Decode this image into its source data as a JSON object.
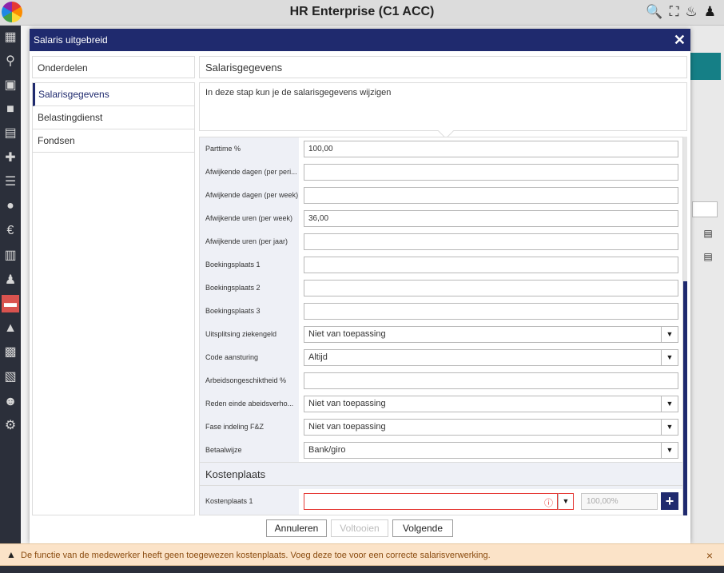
{
  "app": {
    "title": "HR Enterprise (C1 ACC)"
  },
  "topbar_icons": [
    "search-user-icon",
    "team-icon",
    "bell-icon",
    "user-icon"
  ],
  "sidebar_icons": [
    "dashboard-icon",
    "search-icon",
    "org-icon",
    "folder-icon",
    "calendar-icon",
    "medical-icon",
    "report-icon",
    "money-bag-icon",
    "euro-icon",
    "schedule-icon",
    "person-icon",
    "salary-icon",
    "bank-icon",
    "document-icon",
    "file-icon",
    "hand-user-icon",
    "settings-icon"
  ],
  "modal": {
    "title": "Salaris uitgebreid",
    "close_glyph": "✕",
    "nav_head": "Onderdelen",
    "nav_items": [
      "Salarisgegevens",
      "Belastingdienst",
      "Fondsen"
    ],
    "section_title": "Salarisgegevens",
    "info_text": "In deze stap kun je de salarisgegevens wijzigen",
    "fields": [
      {
        "label": "Parttime %",
        "value": "100,00"
      },
      {
        "label": "Afwijkende dagen (per peri...",
        "value": ""
      },
      {
        "label": "Afwijkende dagen (per week)",
        "value": ""
      },
      {
        "label": "Afwijkende uren (per week)",
        "value": "36,00"
      },
      {
        "label": "Afwijkende uren (per jaar)",
        "value": ""
      },
      {
        "label": "Boekingsplaats 1",
        "value": ""
      },
      {
        "label": "Boekingsplaats 2",
        "value": ""
      },
      {
        "label": "Boekingsplaats 3",
        "value": ""
      },
      {
        "label": "Uitsplitsing ziekengeld",
        "value": "Niet van toepassing"
      },
      {
        "label": "Code aansturing",
        "value": "Altijd"
      },
      {
        "label": "Arbeidsongeschiktheid %",
        "value": ""
      },
      {
        "label": "Reden einde abeidsverho...",
        "value": "Niet van toepassing"
      },
      {
        "label": "Fase indeling F&Z",
        "value": "Niet van toepassing"
      },
      {
        "label": "Betaalwijze",
        "value": "Bank/giro"
      }
    ],
    "kostenplaats": {
      "section_title": "Kostenplaats",
      "label": "Kostenplaats 1",
      "value": "",
      "percentage_placeholder": "100,00%",
      "add_glyph": "+"
    },
    "buttons": {
      "cancel": "Annuleren",
      "finish": "Voltooien",
      "next": "Volgende"
    }
  },
  "warning": {
    "text": "De functie van de medewerker heeft geen toegewezen kostenplaats. Voeg deze toe voor een correcte salarisverwerking.",
    "close_glyph": "×"
  }
}
